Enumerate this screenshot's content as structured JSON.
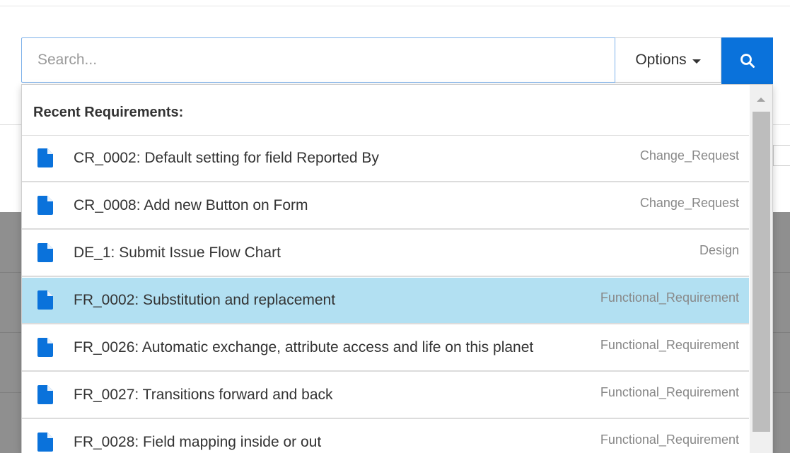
{
  "search": {
    "placeholder": "Search...",
    "value": ""
  },
  "options_button": {
    "label": "Options"
  },
  "search_button": {
    "icon": "search-icon",
    "color": "#0a72db"
  },
  "dropdown": {
    "header": "Recent Requirements:",
    "items": [
      {
        "title": "CR_0002: Default setting for field Reported By",
        "type": "Change_Request",
        "icon": "document-icon",
        "selected": false
      },
      {
        "title": "CR_0008: Add new Button on Form",
        "type": "Change_Request",
        "icon": "document-icon",
        "selected": false
      },
      {
        "title": "DE_1: Submit Issue Flow Chart",
        "type": "Design",
        "icon": "document-icon",
        "selected": false
      },
      {
        "title": "FR_0002: Substitution and replacement",
        "type": "Functional_Requirement",
        "icon": "document-icon",
        "selected": true
      },
      {
        "title": "FR_0026: Automatic exchange, attribute access and life on this planet",
        "type": "Functional_Requirement",
        "icon": "document-icon",
        "selected": false
      },
      {
        "title": "FR_0027: Transitions forward and back",
        "type": "Functional_Requirement",
        "icon": "document-icon",
        "selected": false
      },
      {
        "title": "FR_0028: Field mapping inside or out",
        "type": "Functional_Requirement",
        "icon": "document-icon",
        "selected": false
      }
    ]
  },
  "colors": {
    "accent": "#0a72db",
    "selected_row": "#b2e0f2",
    "icon": "#0a72db"
  }
}
